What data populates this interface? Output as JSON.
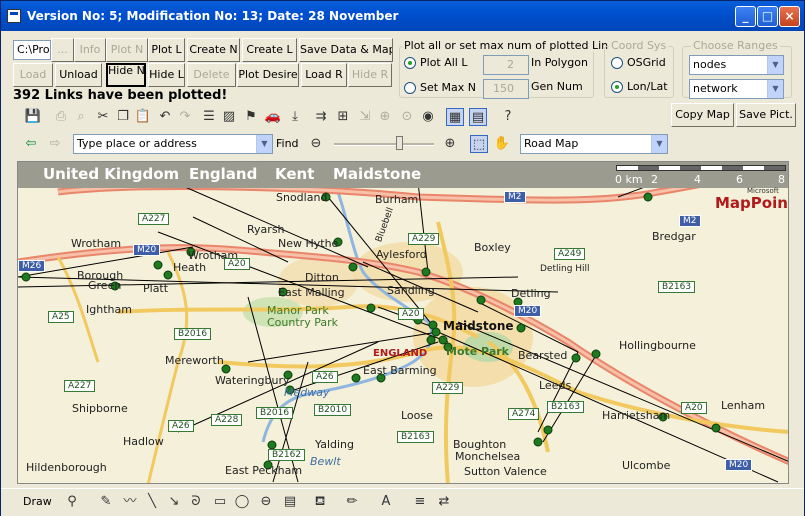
{
  "window": {
    "title": "Version No: 5;  Modification No: 13;  Date: 28 November"
  },
  "path_input": {
    "value": "C:\\Prog"
  },
  "buttons": {
    "browse": "...",
    "info": "Info",
    "plot_n": "Plot N",
    "plot_l": "Plot L",
    "create_n": "Create N",
    "create_l": "Create L",
    "save_data_map": "Save Data & Map",
    "load": "Load",
    "unload": "Unload",
    "hide_n": "Hide N",
    "hide_l": "Hide L",
    "delete": "Delete",
    "plot_desire": "Plot Desire",
    "load_r": "Load R",
    "hide_r": "Hide R",
    "copy_map": "Copy Map",
    "save_pict": "Save Pict."
  },
  "plot_group": {
    "title": "Plot all or set max num of plotted Links",
    "plot_all": "Plot All L",
    "set_max": "Set Max N",
    "in_polygon_value": "2",
    "in_polygon_label": "In Polygon",
    "gen_num_value": "150",
    "gen_num_label": "Gen Num"
  },
  "coord_group": {
    "title": "Coord Sys",
    "osgrid": "OSGrid",
    "lonlat": "Lon/Lat"
  },
  "ranges_group": {
    "title": "Choose Ranges",
    "range1": "nodes",
    "range2": "network"
  },
  "status": "392 Links have been plotted!",
  "nav": {
    "address_placeholder": "Type place or address",
    "find": "Find",
    "map_style": "Road Map"
  },
  "map": {
    "breadcrumbs": [
      "United Kingdom",
      "England",
      "Kent",
      "Maidstone"
    ],
    "scale_labels": [
      "0 km",
      "2",
      "4",
      "6",
      "8"
    ],
    "logo": "MapPoint",
    "logo_brand": "Microsoft",
    "places": {
      "snodland": "Snodland",
      "burham": "Burham",
      "ryarsh": "Ryarsh",
      "wrotham": "Wrotham",
      "wrotham_heath": "Wrotham",
      "heath": "Heath",
      "new_hythe": "New Hythe",
      "aylesford": "Aylesford",
      "boxley": "Boxley",
      "bredgar": "Bredgar",
      "borough": "Borough",
      "green": "Green",
      "platt": "Platt",
      "ditton": "Ditton",
      "detling_hill": "Detling Hill",
      "ightham": "Ightham",
      "east_malling": "East Malling",
      "sandling": "Sandling",
      "detling": "Detling",
      "manor_park": "Manor Park",
      "country_park": "Country Park",
      "maidstone": "Maidstone",
      "mote_park": "Mote Park",
      "hollingbourne": "Hollingbourne",
      "mereworth": "Mereworth",
      "england": "ENGLAND",
      "bearsted": "Bearsted",
      "east_barming": "East Barming",
      "waterinbury": "Wateringbury",
      "medway": "Medway",
      "leeds": "Leeds",
      "shipborne": "Shipborne",
      "harrietsham": "Harrietsham",
      "lenham": "Lenham",
      "loose": "Loose",
      "hadlow": "Hadlow",
      "yalding": "Yalding",
      "boughton": "Boughton",
      "monchelsea": "Monchelsea",
      "bewlt": "Bewlt",
      "hildenborough": "Hildenborough",
      "east_peckham": "East Peckham",
      "sutton_valence": "Sutton Valence",
      "ulcombe": "Ulcombe",
      "bluebell": "Bluebell"
    },
    "roads": {
      "a227": "A227",
      "m20a": "M20",
      "m20b": "M20",
      "m20c": "M20",
      "m20d": "M20",
      "m26": "M26",
      "m2a": "M2",
      "m2b": "M2",
      "a20a": "A20",
      "a20b": "A20",
      "a20c": "A20",
      "a229a": "A229",
      "a229b": "A229",
      "a249": "A249",
      "a25": "A25",
      "b2016a": "B2016",
      "b2016b": "B2016",
      "b2163a": "B2163",
      "b2163b": "B2163",
      "b2163c": "B2163",
      "a26a": "A26",
      "a26b": "A26",
      "a228": "A228",
      "b2010": "B2010",
      "a274": "A274",
      "b2162": "B2162",
      "a227b": "A227"
    }
  },
  "drawbar": {
    "draw": "Draw"
  },
  "colors": {
    "title": "#0046b8",
    "motorway": "#e9856a",
    "road": "#f2d07a",
    "nodes": "#1f7a1f"
  }
}
